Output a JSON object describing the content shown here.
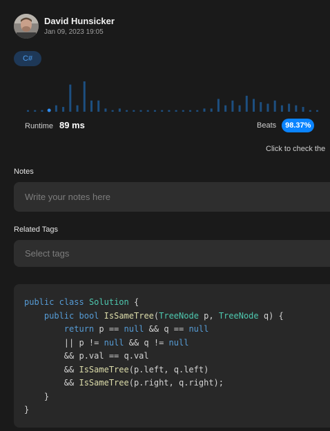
{
  "user": {
    "name": "David Hunsicker",
    "timestamp": "Jan 09, 2023 19:05"
  },
  "language_badge": "C#",
  "histogram": {
    "bar_values": [
      1,
      1,
      1,
      2,
      4,
      3,
      17,
      4,
      19,
      7,
      7,
      2,
      1,
      2,
      1,
      1,
      1,
      1,
      1,
      1,
      1,
      1,
      1,
      1,
      1,
      2,
      2,
      8,
      4,
      7,
      4,
      10,
      8,
      6,
      5,
      7,
      4,
      5,
      4,
      3,
      1,
      1
    ],
    "highlight_index": 3,
    "bar_color": "#1d4f80",
    "highlight_color": "#2f8cf0"
  },
  "runtime": {
    "label": "Runtime",
    "value": "89 ms"
  },
  "beats": {
    "label": "Beats",
    "value": "98.37%"
  },
  "check_hint": "Click to check the",
  "notes": {
    "label": "Notes",
    "placeholder": "Write your notes here"
  },
  "tags": {
    "label": "Related Tags",
    "placeholder": "Select tags"
  },
  "code": {
    "lines": [
      [
        [
          "kw",
          "public"
        ],
        [
          "",
          "&nbsp;"
        ],
        [
          "kw",
          "class"
        ],
        [
          "",
          "&nbsp;"
        ],
        [
          "ty",
          "Solution"
        ],
        [
          "",
          "&nbsp;{"
        ]
      ],
      [
        [
          "",
          "    "
        ],
        [
          "kw",
          "public"
        ],
        [
          "",
          "&nbsp;"
        ],
        [
          "kw",
          "bool"
        ],
        [
          "",
          "&nbsp;"
        ],
        [
          "fn",
          "IsSameTree"
        ],
        [
          "",
          "("
        ],
        [
          "ty",
          "TreeNode"
        ],
        [
          "",
          "&nbsp;p,&nbsp;"
        ],
        [
          "ty",
          "TreeNode"
        ],
        [
          "",
          "&nbsp;q)&nbsp;{"
        ]
      ],
      [
        [
          "",
          "        "
        ],
        [
          "kw",
          "return"
        ],
        [
          "",
          "&nbsp;p&nbsp;==&nbsp;"
        ],
        [
          "kw",
          "null"
        ],
        [
          "",
          "&nbsp;&amp;&amp;&nbsp;q&nbsp;==&nbsp;"
        ],
        [
          "kw",
          "null"
        ]
      ],
      [
        [
          "",
          "        ||&nbsp;p&nbsp;!=&nbsp;"
        ],
        [
          "kw",
          "null"
        ],
        [
          "",
          "&nbsp;&amp;&amp;&nbsp;q&nbsp;!=&nbsp;"
        ],
        [
          "kw",
          "null"
        ]
      ],
      [
        [
          "",
          "        &amp;&amp;&nbsp;p.val&nbsp;==&nbsp;q.val"
        ]
      ],
      [
        [
          "",
          "        &amp;&amp;&nbsp;"
        ],
        [
          "fn",
          "IsSameTree"
        ],
        [
          "",
          "(p.left,&nbsp;q.left)"
        ]
      ],
      [
        [
          "",
          "        &amp;&amp;&nbsp;"
        ],
        [
          "fn",
          "IsSameTree"
        ],
        [
          "",
          "(p.right,&nbsp;q.right);"
        ]
      ],
      [
        [
          "",
          "    }"
        ]
      ],
      [
        [
          "",
          "}"
        ]
      ]
    ]
  }
}
